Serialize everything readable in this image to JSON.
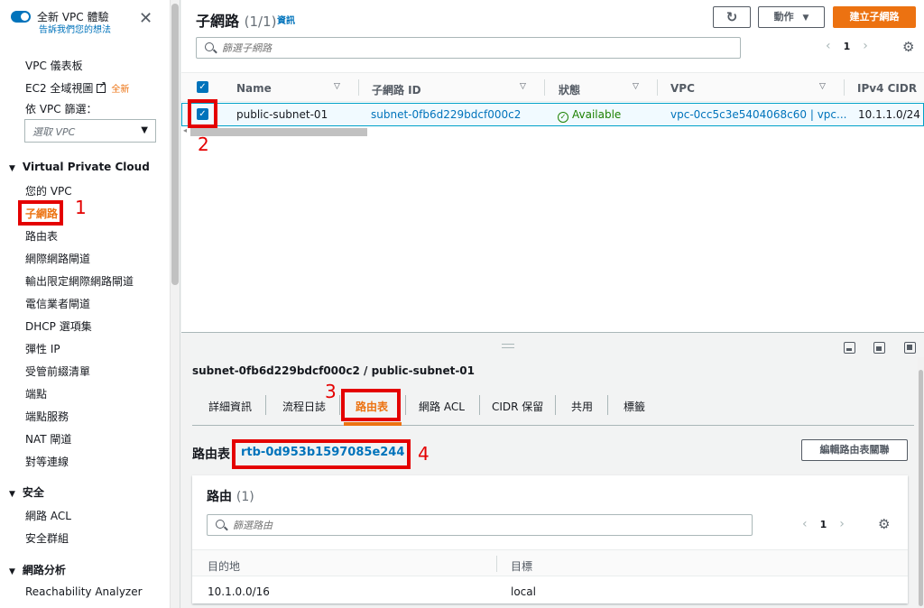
{
  "sidebar": {
    "banner_title": "全新 VPC 體驗",
    "banner_subtitle": "告訴我們您的想法",
    "links": {
      "dashboard": "VPC 儀表板",
      "ec2_global": "EC2 全域視圖",
      "new_badge": "全新"
    },
    "filter_label": "依 VPC 篩選：",
    "filter_placeholder": "選取 VPC",
    "sections": [
      {
        "title": "Virtual Private Cloud",
        "items": [
          "您的 VPC",
          "子網路",
          "路由表",
          "網際網路閘道",
          "輸出限定網際網路閘道",
          "電信業者閘道",
          "DHCP 選項集",
          "彈性 IP",
          "受管前綴清單",
          "端點",
          "端點服務",
          "NAT 閘道",
          "對等連線"
        ]
      },
      {
        "title": "安全",
        "items": [
          "網路 ACL",
          "安全群組"
        ]
      },
      {
        "title": "網路分析",
        "items": [
          "Reachability Analyzer"
        ]
      }
    ]
  },
  "header": {
    "title": "子網路",
    "count": "(1/1)",
    "info": "資訊",
    "actions_label": "動作",
    "create_label": "建立子網路",
    "search_placeholder": "篩選子網路",
    "page": "1"
  },
  "table": {
    "columns": [
      "Name",
      "子網路 ID",
      "狀態",
      "VPC",
      "IPv4 CIDR"
    ],
    "rows": [
      {
        "name": "public-subnet-01",
        "subnet_id": "subnet-0fb6d229bdcf000c2",
        "status": "Available",
        "vpc": "vpc-0cc5c3e5404068c60 | vpc...",
        "cidr": "10.1.1.0/24"
      }
    ]
  },
  "detail": {
    "title": "subnet-0fb6d229bdcf000c2 / public-subnet-01",
    "tabs": [
      "詳細資訊",
      "流程日誌",
      "路由表",
      "網路 ACL",
      "CIDR 保留",
      "共用",
      "標籤"
    ],
    "route_table_label": "路由表",
    "route_table_id": "rtb-0d953b1597085e244",
    "edit_assoc_label": "編輯路由表關聯",
    "routes": {
      "title": "路由",
      "count": "(1)",
      "search_placeholder": "篩選路由",
      "page": "1",
      "columns": [
        "目的地",
        "目標"
      ],
      "rows": [
        {
          "destination": "10.1.0.0/16",
          "target": "local"
        }
      ]
    }
  },
  "annotations": [
    "1",
    "2",
    "3",
    "4"
  ],
  "colors": {
    "accent": "#ec7211",
    "link": "#0073bb",
    "highlight": "#e40000",
    "success": "#1d8102"
  }
}
